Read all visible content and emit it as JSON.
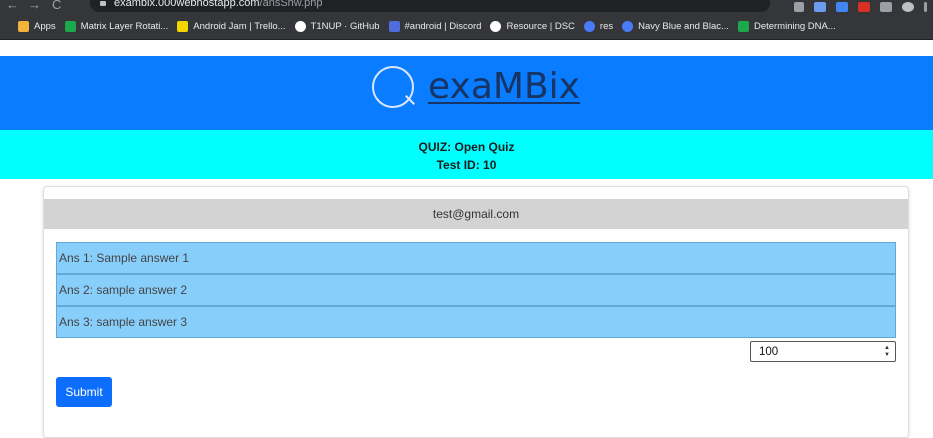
{
  "browser": {
    "nav_glyphs": {
      "back": "←",
      "forward": "→",
      "reload": "C"
    },
    "url_host": "exambix.000webhostapp.com",
    "url_path": "/ansShw.php",
    "bookmarks": [
      {
        "label": "Apps",
        "icon": "apps-grid-icon",
        "color": "#f2b33d"
      },
      {
        "label": "Matrix Layer Rotati...",
        "icon": "hackerrank-icon",
        "color": "#1ba94c"
      },
      {
        "label": "Android Jam | Trello...",
        "icon": "trello-icon",
        "color": "#f2d600"
      },
      {
        "label": "T1NUP · GitHub",
        "icon": "github-icon",
        "color": "#ffffff"
      },
      {
        "label": "#android | Discord",
        "icon": "discord-icon",
        "color": "#4f6bdc"
      },
      {
        "label": "Resource | DSC",
        "icon": "github-icon",
        "color": "#ffffff"
      },
      {
        "label": "res",
        "icon": "c-circle-icon",
        "color": "#4a7bf7"
      },
      {
        "label": "Navy Blue and Blac...",
        "icon": "c-circle-icon",
        "color": "#4a7bf7"
      },
      {
        "label": "Determining DNA...",
        "icon": "hackerrank-icon",
        "color": "#1ba94c"
      }
    ]
  },
  "header": {
    "brand_letter": "Q",
    "brand_name": "exaMBix"
  },
  "quiz": {
    "title": "QUIZ: Open Quiz",
    "test_id": "Test ID: 10"
  },
  "card": {
    "email": "test@gmail.com",
    "answers": [
      "Ans 1: Sample answer 1",
      "Ans 2: sample answer 2",
      "Ans 3: sample answer 3"
    ],
    "score_value": "100",
    "spinner_glyphs": {
      "up": "▲",
      "down": "▼"
    },
    "submit_label": "Submit"
  }
}
